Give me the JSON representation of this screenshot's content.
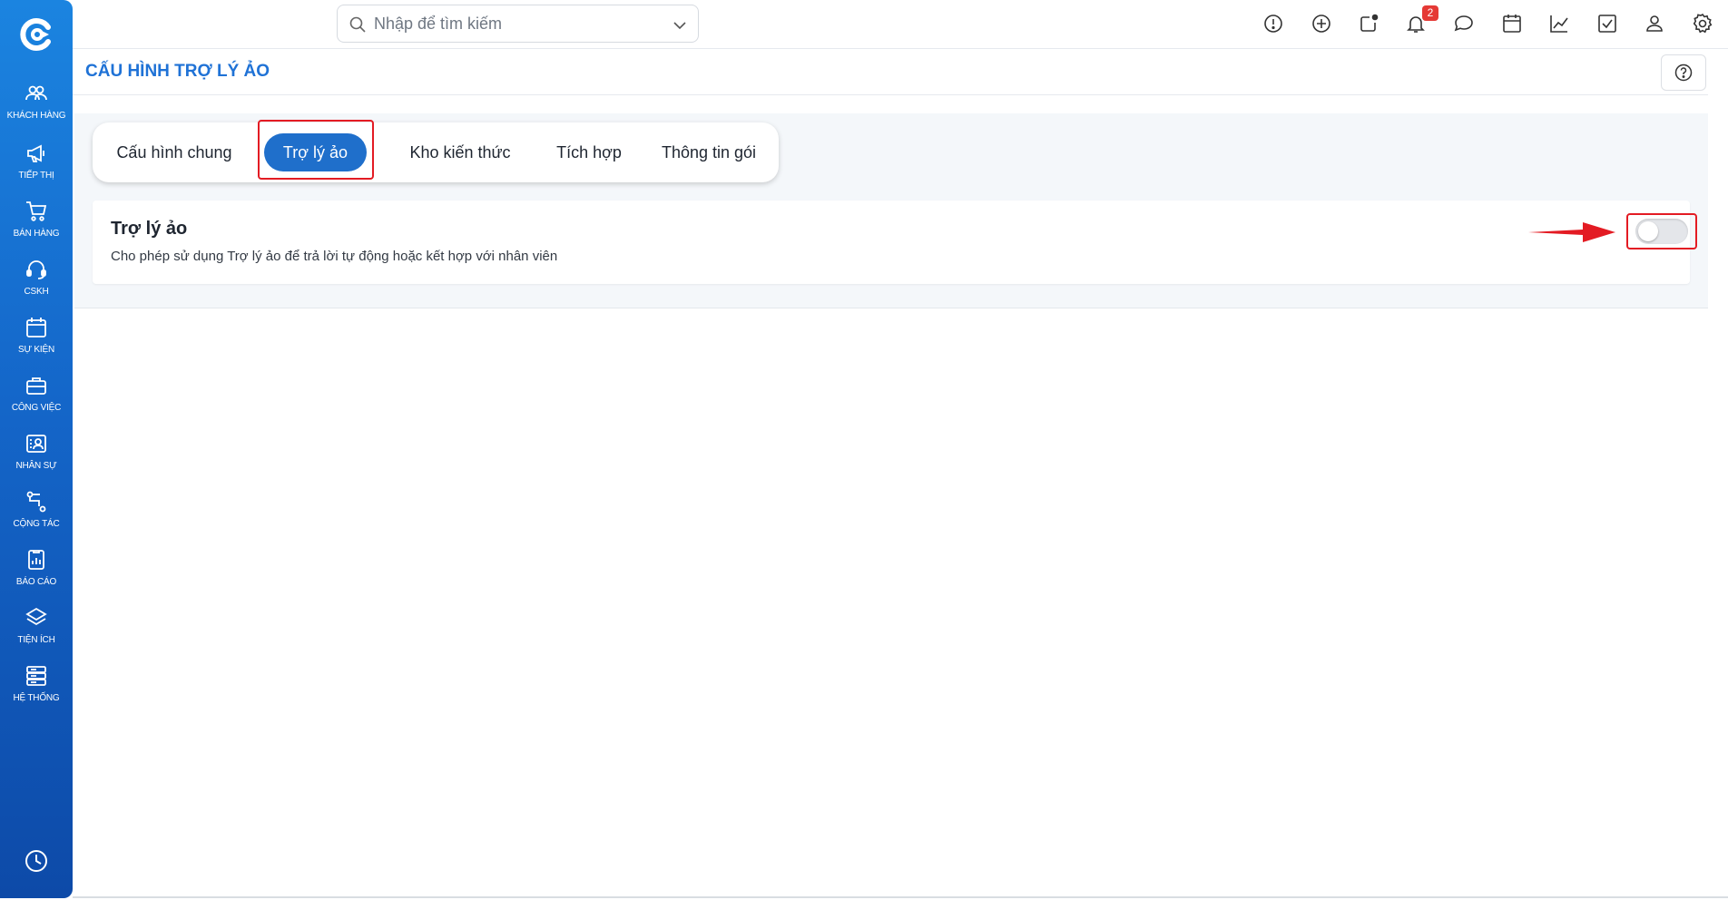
{
  "sidebar": {
    "items": [
      {
        "label": "KHÁCH HÀNG",
        "icon": "users-icon"
      },
      {
        "label": "TIẾP THỊ",
        "icon": "megaphone-icon"
      },
      {
        "label": "BÁN HÀNG",
        "icon": "cart-icon"
      },
      {
        "label": "CSKH",
        "icon": "headset-icon"
      },
      {
        "label": "SỰ KIỆN",
        "icon": "calendar-icon"
      },
      {
        "label": "CÔNG VIỆC",
        "icon": "briefcase-icon"
      },
      {
        "label": "NHÂN SỰ",
        "icon": "id-card-icon"
      },
      {
        "label": "CỘNG TÁC",
        "icon": "connector-icon"
      },
      {
        "label": "BÁO CÁO",
        "icon": "report-icon"
      },
      {
        "label": "TIỆN ÍCH",
        "icon": "layers-icon"
      },
      {
        "label": "HỆ THỐNG",
        "icon": "server-icon"
      }
    ],
    "bottom_icon": "history-icon"
  },
  "header": {
    "search_placeholder": "Nhập để tìm kiếm",
    "notification_count": "2",
    "icons": [
      "alert-icon",
      "plus-circle-icon",
      "chat-dot-icon",
      "bell-icon",
      "message-icon",
      "calendar-icon",
      "chart-line-icon",
      "checkbox-icon",
      "user-icon",
      "gear-icon"
    ]
  },
  "page": {
    "title": "CẤU HÌNH TRỢ LÝ ẢO"
  },
  "tabs": [
    {
      "label": "Cấu hình chung",
      "active": false
    },
    {
      "label": "Trợ lý ảo",
      "active": true
    },
    {
      "label": "Kho kiến thức",
      "active": false
    },
    {
      "label": "Tích hợp",
      "active": false
    },
    {
      "label": "Thông tin gói",
      "active": false
    }
  ],
  "setting": {
    "title": "Trợ lý ảo",
    "description": "Cho phép sử dụng Trợ lý ảo để trả lời tự động hoặc kết hợp với nhân viên",
    "enabled": false
  },
  "colors": {
    "brand": "#1f72d6",
    "active_tab": "#1f6fcb",
    "highlight": "#e31b23"
  }
}
